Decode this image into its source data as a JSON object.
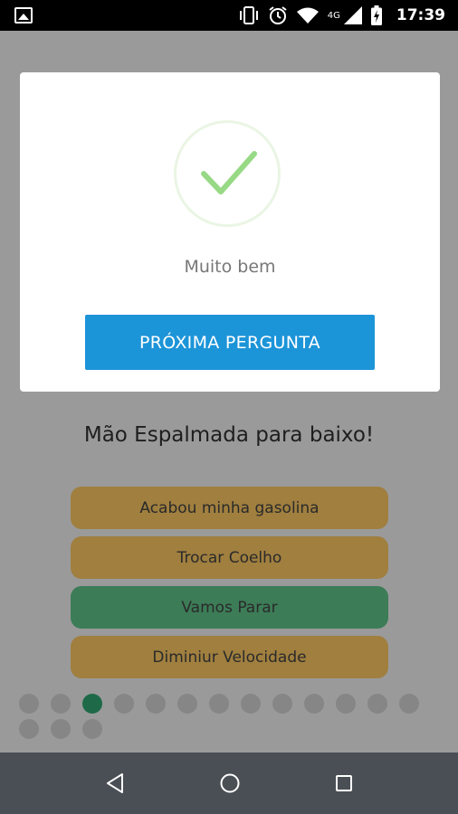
{
  "status_bar": {
    "network": "4G",
    "time": "17:39",
    "icons": [
      "image-icon",
      "vibrate-icon",
      "alarm-icon",
      "wifi-icon",
      "signal-icon",
      "battery-charging-icon"
    ]
  },
  "dialog": {
    "icon": "check-icon",
    "message": "Muito bem",
    "button_label": "PRÓXIMA PERGUNTA"
  },
  "quiz": {
    "question": "Mão Espalmada para baixo!",
    "answers": [
      {
        "label": "Acabou minha gasolina",
        "state": "default"
      },
      {
        "label": "Trocar Coelho",
        "state": "default"
      },
      {
        "label": "Vamos Parar",
        "state": "correct"
      },
      {
        "label": "Diminiur Velocidade",
        "state": "default"
      }
    ],
    "progress": {
      "total": 16,
      "current": 3
    },
    "colors": {
      "answer_default": "#a07f3f",
      "answer_correct": "#3c7c57",
      "dot_active": "#1e6a48",
      "button": "#1c94d8"
    }
  },
  "nav_bar": {
    "buttons": [
      "back-icon",
      "home-icon",
      "recents-icon"
    ]
  }
}
